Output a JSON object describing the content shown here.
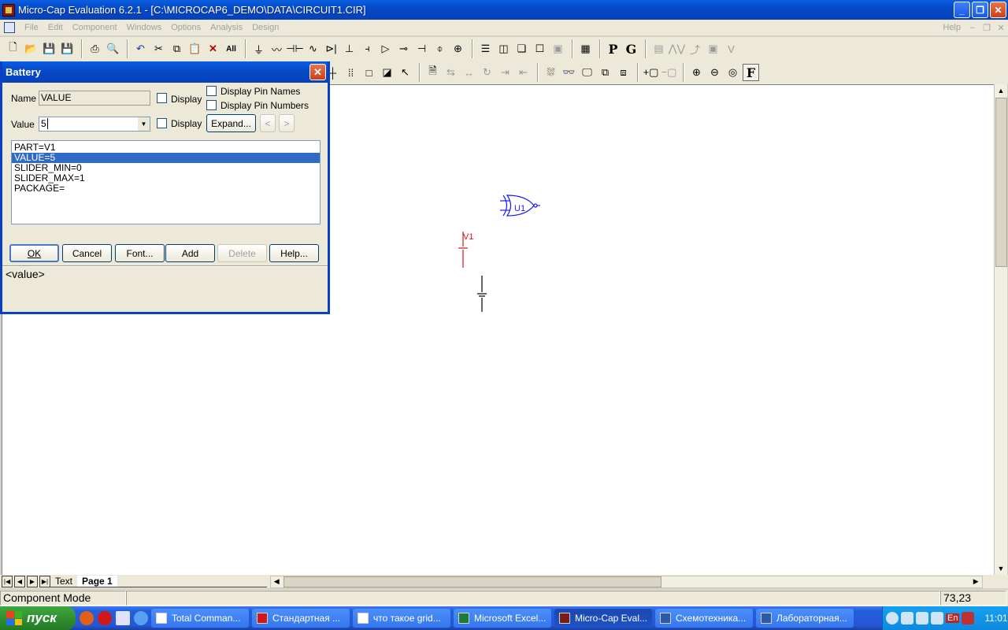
{
  "window": {
    "title": "Micro-Cap Evaluation 6.2.1 - [C:\\MICROCAP6_DEMO\\DATA\\CIRCUIT1.CIR]",
    "min": "_",
    "max": "❐",
    "close": "✕"
  },
  "menu": {
    "items": [
      "File",
      "Edit",
      "Component",
      "Windows",
      "Options",
      "Analysis",
      "Design"
    ],
    "help": "Help"
  },
  "toolbar1": {
    "icons": [
      "new-icon",
      "open-icon",
      "save-icon",
      "save-all-icon",
      "print-icon",
      "print-preview-icon",
      "undo-icon",
      "cut-icon",
      "copy-icon",
      "paste-icon",
      "delete-icon",
      "select-all-icon",
      "ground-icon",
      "resistor-icon",
      "capacitor-icon",
      "inductor-icon",
      "diode-icon",
      "battery-icon",
      "npn-icon",
      "opamp-icon",
      "transistor-icon",
      "nmos-icon",
      "current-source-icon",
      "voltage-source-icon",
      "tile-horizontal-icon",
      "tile-vertical-icon",
      "cascade-icon",
      "window-icon",
      "page-icon",
      "calculator-icon"
    ],
    "letters": [
      "P",
      "G"
    ]
  },
  "toolbar2": {
    "letters": [
      "F"
    ]
  },
  "dialog": {
    "title": "Battery",
    "name_label": "Name",
    "name_value": "VALUE",
    "display_label_1": "Display",
    "display_label_2": "Display",
    "display_pin_names": "Display Pin Names",
    "display_pin_numbers": "Display Pin Numbers",
    "value_label": "Value",
    "value_value": "5",
    "expand_button": "Expand...",
    "prev_button": "<",
    "next_button": ">",
    "attributes": [
      "PART=V1",
      "VALUE=5",
      "SLIDER_MIN=0",
      "SLIDER_MAX=1",
      "PACKAGE="
    ],
    "selected_attribute": 1,
    "buttons": {
      "ok": "OK",
      "cancel": "Cancel",
      "font": "Font...",
      "add": "Add",
      "delete": "Delete",
      "help": "Help..."
    },
    "hint": "<value>"
  },
  "schematic": {
    "gate_label": "U1",
    "battery_label": "V1",
    "colors": {
      "gate": "#1a1aff",
      "battery": "#e01010",
      "wire": "#000000"
    }
  },
  "tabs": {
    "text_tab": "Text",
    "page_tab": "Page 1"
  },
  "status": {
    "mode": "Component Mode",
    "coords": "73,23"
  },
  "taskbar": {
    "start": "пуск",
    "buttons": [
      "Total Comman...",
      "Стандартная ...",
      "что такое grid...",
      "Microsoft Excel...",
      "Micro-Cap Eval...",
      "Схемотехника...",
      "Лабораторная..."
    ],
    "active_index": 4,
    "lang": "En",
    "clock": "11:01"
  }
}
